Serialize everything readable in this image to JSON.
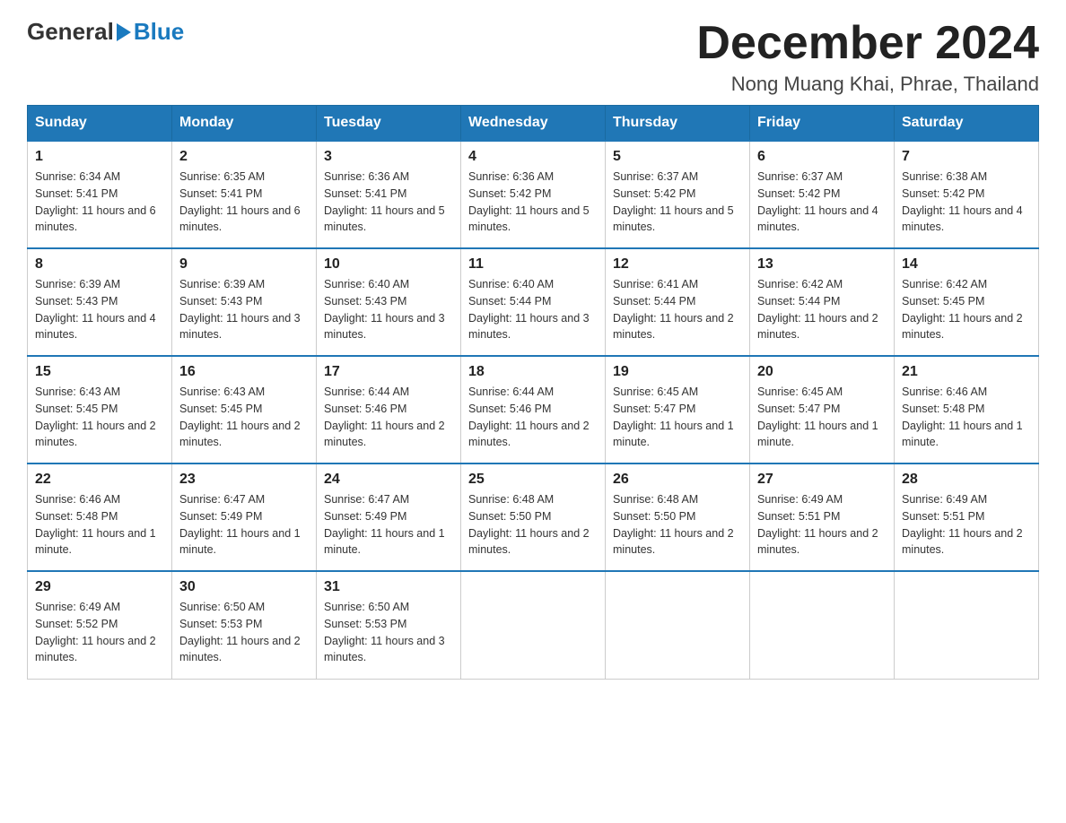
{
  "header": {
    "logo_general": "General",
    "logo_blue": "Blue",
    "month_title": "December 2024",
    "location": "Nong Muang Khai, Phrae, Thailand"
  },
  "weekdays": [
    "Sunday",
    "Monday",
    "Tuesday",
    "Wednesday",
    "Thursday",
    "Friday",
    "Saturday"
  ],
  "weeks": [
    [
      {
        "day": "1",
        "sunrise": "6:34 AM",
        "sunset": "5:41 PM",
        "daylight": "11 hours and 6 minutes."
      },
      {
        "day": "2",
        "sunrise": "6:35 AM",
        "sunset": "5:41 PM",
        "daylight": "11 hours and 6 minutes."
      },
      {
        "day": "3",
        "sunrise": "6:36 AM",
        "sunset": "5:41 PM",
        "daylight": "11 hours and 5 minutes."
      },
      {
        "day": "4",
        "sunrise": "6:36 AM",
        "sunset": "5:42 PM",
        "daylight": "11 hours and 5 minutes."
      },
      {
        "day": "5",
        "sunrise": "6:37 AM",
        "sunset": "5:42 PM",
        "daylight": "11 hours and 5 minutes."
      },
      {
        "day": "6",
        "sunrise": "6:37 AM",
        "sunset": "5:42 PM",
        "daylight": "11 hours and 4 minutes."
      },
      {
        "day": "7",
        "sunrise": "6:38 AM",
        "sunset": "5:42 PM",
        "daylight": "11 hours and 4 minutes."
      }
    ],
    [
      {
        "day": "8",
        "sunrise": "6:39 AM",
        "sunset": "5:43 PM",
        "daylight": "11 hours and 4 minutes."
      },
      {
        "day": "9",
        "sunrise": "6:39 AM",
        "sunset": "5:43 PM",
        "daylight": "11 hours and 3 minutes."
      },
      {
        "day": "10",
        "sunrise": "6:40 AM",
        "sunset": "5:43 PM",
        "daylight": "11 hours and 3 minutes."
      },
      {
        "day": "11",
        "sunrise": "6:40 AM",
        "sunset": "5:44 PM",
        "daylight": "11 hours and 3 minutes."
      },
      {
        "day": "12",
        "sunrise": "6:41 AM",
        "sunset": "5:44 PM",
        "daylight": "11 hours and 2 minutes."
      },
      {
        "day": "13",
        "sunrise": "6:42 AM",
        "sunset": "5:44 PM",
        "daylight": "11 hours and 2 minutes."
      },
      {
        "day": "14",
        "sunrise": "6:42 AM",
        "sunset": "5:45 PM",
        "daylight": "11 hours and 2 minutes."
      }
    ],
    [
      {
        "day": "15",
        "sunrise": "6:43 AM",
        "sunset": "5:45 PM",
        "daylight": "11 hours and 2 minutes."
      },
      {
        "day": "16",
        "sunrise": "6:43 AM",
        "sunset": "5:45 PM",
        "daylight": "11 hours and 2 minutes."
      },
      {
        "day": "17",
        "sunrise": "6:44 AM",
        "sunset": "5:46 PM",
        "daylight": "11 hours and 2 minutes."
      },
      {
        "day": "18",
        "sunrise": "6:44 AM",
        "sunset": "5:46 PM",
        "daylight": "11 hours and 2 minutes."
      },
      {
        "day": "19",
        "sunrise": "6:45 AM",
        "sunset": "5:47 PM",
        "daylight": "11 hours and 1 minute."
      },
      {
        "day": "20",
        "sunrise": "6:45 AM",
        "sunset": "5:47 PM",
        "daylight": "11 hours and 1 minute."
      },
      {
        "day": "21",
        "sunrise": "6:46 AM",
        "sunset": "5:48 PM",
        "daylight": "11 hours and 1 minute."
      }
    ],
    [
      {
        "day": "22",
        "sunrise": "6:46 AM",
        "sunset": "5:48 PM",
        "daylight": "11 hours and 1 minute."
      },
      {
        "day": "23",
        "sunrise": "6:47 AM",
        "sunset": "5:49 PM",
        "daylight": "11 hours and 1 minute."
      },
      {
        "day": "24",
        "sunrise": "6:47 AM",
        "sunset": "5:49 PM",
        "daylight": "11 hours and 1 minute."
      },
      {
        "day": "25",
        "sunrise": "6:48 AM",
        "sunset": "5:50 PM",
        "daylight": "11 hours and 2 minutes."
      },
      {
        "day": "26",
        "sunrise": "6:48 AM",
        "sunset": "5:50 PM",
        "daylight": "11 hours and 2 minutes."
      },
      {
        "day": "27",
        "sunrise": "6:49 AM",
        "sunset": "5:51 PM",
        "daylight": "11 hours and 2 minutes."
      },
      {
        "day": "28",
        "sunrise": "6:49 AM",
        "sunset": "5:51 PM",
        "daylight": "11 hours and 2 minutes."
      }
    ],
    [
      {
        "day": "29",
        "sunrise": "6:49 AM",
        "sunset": "5:52 PM",
        "daylight": "11 hours and 2 minutes."
      },
      {
        "day": "30",
        "sunrise": "6:50 AM",
        "sunset": "5:53 PM",
        "daylight": "11 hours and 2 minutes."
      },
      {
        "day": "31",
        "sunrise": "6:50 AM",
        "sunset": "5:53 PM",
        "daylight": "11 hours and 3 minutes."
      },
      null,
      null,
      null,
      null
    ]
  ],
  "labels": {
    "sunrise": "Sunrise:",
    "sunset": "Sunset:",
    "daylight": "Daylight:"
  }
}
